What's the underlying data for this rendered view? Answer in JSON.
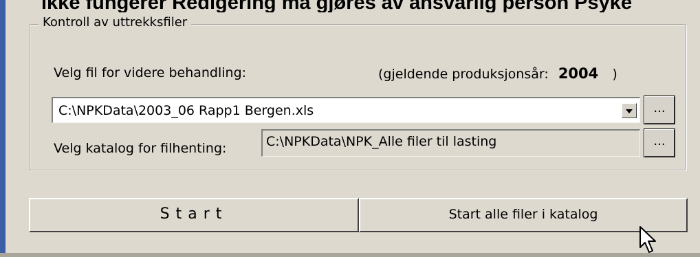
{
  "banner_text": "ikke fungerer Redigering må gjøres av ansvarlig person Psyke",
  "groupbox": {
    "title": "Kontroll av uttrekksfiler"
  },
  "file_select": {
    "label": "Velg fil for videre behandling:",
    "year_label": "(gjeldende produksjonsår:",
    "year_value": "2004",
    "year_close": ")",
    "selected_file": "C:\\NPKData\\2003_06 Rapp1 Bergen.xls",
    "browse_label": "..."
  },
  "dir_select": {
    "label": "Velg katalog for filhenting:",
    "value": "C:\\NPKData\\NPK_Alle filer til lasting",
    "browse_label": "..."
  },
  "buttons": {
    "start": "Start",
    "start_all": "Start alle filer i katalog"
  },
  "colors": {
    "window_bg": "#ddd9cf",
    "accent_bar": "#3a5ea8"
  }
}
